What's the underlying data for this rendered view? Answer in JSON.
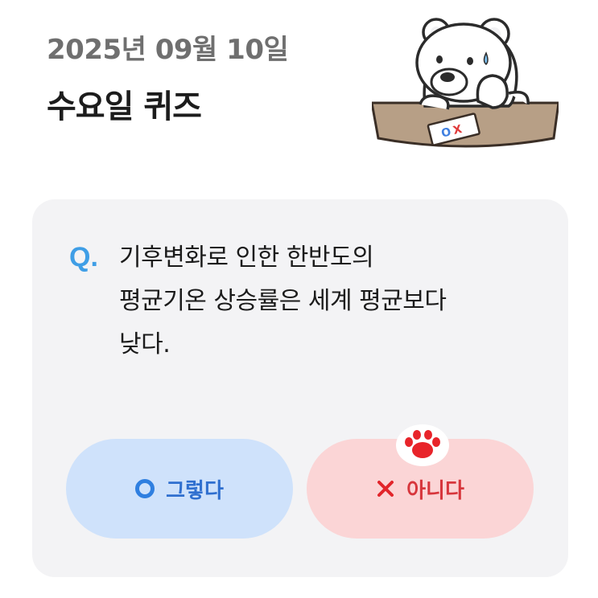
{
  "header": {
    "date": "2025년 09월 10일",
    "title": "수요일 퀴즈"
  },
  "mascot": {
    "icon": "polar-bear-mascot-icon",
    "card_text": "OX"
  },
  "quiz": {
    "q_mark": "Q.",
    "question_lines": [
      "기후변화로 인한 한반도의",
      "평균기온 상승률은 세계 평균보다",
      "낮다."
    ]
  },
  "answers": {
    "yes_label": "그렇다",
    "no_label": "아니다",
    "selected_marker_icon": "paw-icon"
  },
  "colors": {
    "accent_blue": "#3f9ee6",
    "yes_bg": "#cfe2fb",
    "no_bg": "#fbd5d6",
    "no_text": "#d7363c",
    "yes_text": "#2f6fcf"
  }
}
